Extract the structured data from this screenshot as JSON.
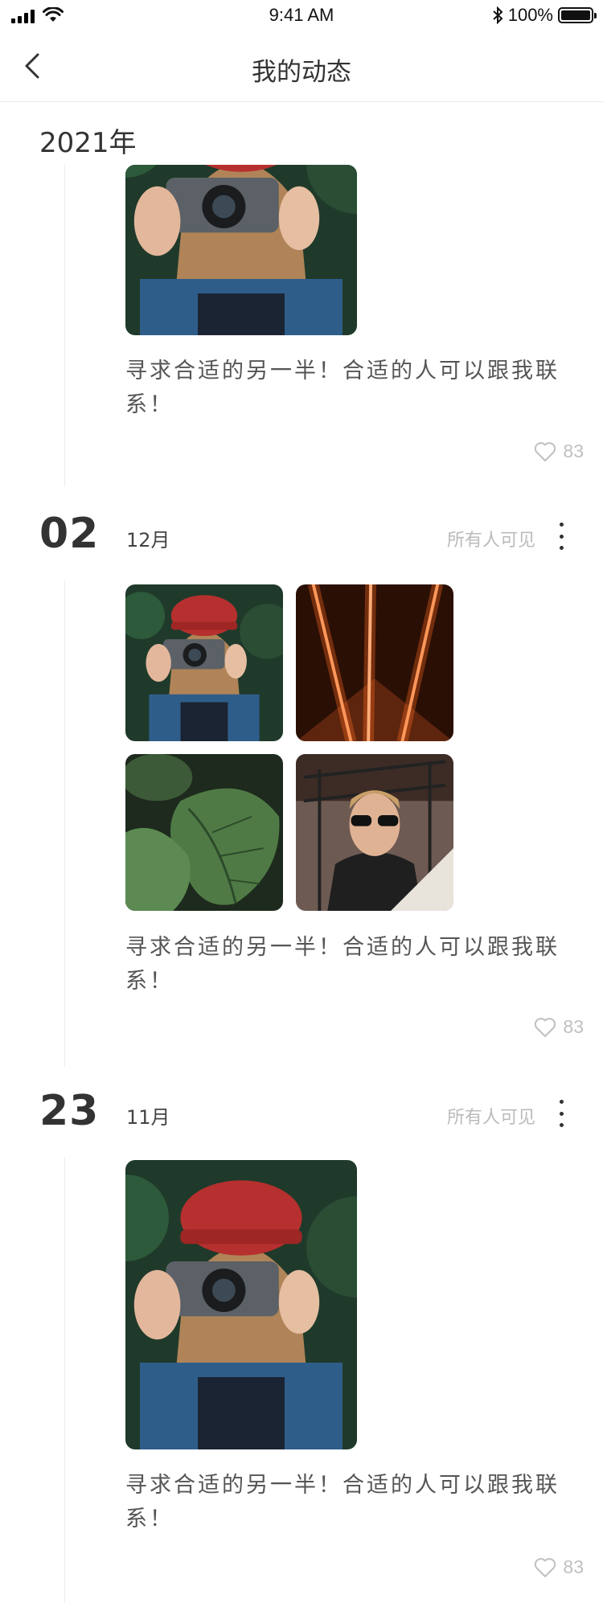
{
  "status_bar": {
    "time": "9:41 AM",
    "battery": "100%"
  },
  "header": {
    "title": "我的动态"
  },
  "year": "2021年",
  "colors": {
    "text": "#333333",
    "muted": "#bbbbbb",
    "divider": "#ececec"
  },
  "posts": [
    {
      "text": "寻求合适的另一半！合适的人可以跟我联系！",
      "likes": "83",
      "photos": [
        "woman-camera-photo"
      ]
    },
    {
      "day": "02",
      "month": "12月",
      "visibility": "所有人可见",
      "text": "寻求合适的另一半！合适的人可以跟我联系！",
      "likes": "83",
      "photos": [
        "woman-camera-photo",
        "sparks-photo",
        "leaf-photo",
        "man-sunglasses-photo"
      ]
    },
    {
      "day": "23",
      "month": "11月",
      "visibility": "所有人可见",
      "text": "寻求合适的另一半！合适的人可以跟我联系！",
      "likes": "83",
      "photos": [
        "woman-camera-photo"
      ]
    }
  ]
}
